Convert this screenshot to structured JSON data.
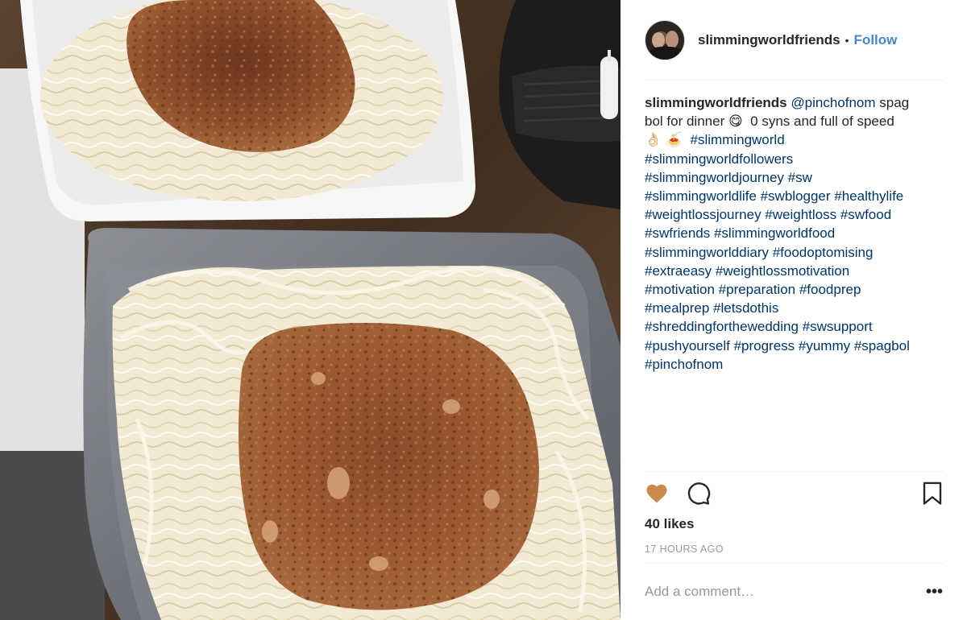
{
  "post": {
    "username": "slimmingworldfriends",
    "follow_label": "Follow",
    "separator": "•",
    "caption": {
      "username": "slimmingworldfriends",
      "mention": "@pinchofnom",
      "line1_rest": " spag",
      "line2": "bol for dinner",
      "line2_emoji": "😋",
      "line2_rest": "0 syns and full of speed",
      "line3_emoji": "👌🏻 🍝",
      "hashtags_line3": "#slimmingworld",
      "hashtag_lines": [
        "#slimmingworldfollowers",
        "#slimmingworldjourney #sw",
        "#slimmingworldlife #swblogger #healthylife",
        "#weightlossjourney #weightloss #swfood",
        "#swfriends #slimmingworldfood",
        "#slimmingworlddiary #foodoptomising",
        "#extraeasy #weightlossmotivation",
        "#motivation #preparation #foodprep",
        "#mealprep #letsdothis",
        "#shreddingforthewedding #swsupport",
        "#pushyourself #progress #yummy #spagbol",
        "#pinchofnom"
      ]
    },
    "likes": "40 likes",
    "timestamp": "17 HOURS AGO",
    "comment_placeholder": "Add a comment…",
    "more_label": "•••",
    "icons": {
      "like": "heart-icon",
      "comment": "comment-icon",
      "save": "bookmark-icon",
      "more": "more-options-icon"
    },
    "colors": {
      "liked_heart": "#c98a4b",
      "link": "#003569",
      "follow": "#4a86c8",
      "muted": "#999999"
    }
  }
}
